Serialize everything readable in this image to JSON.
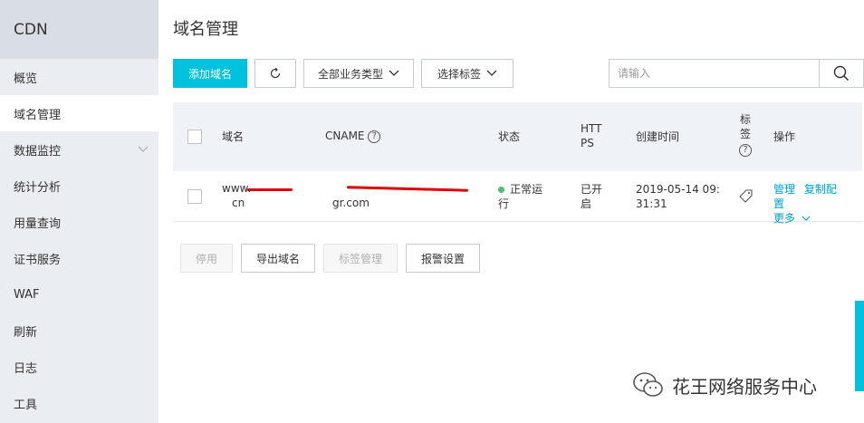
{
  "sidebar": {
    "title": "CDN",
    "items": [
      {
        "label": "概览"
      },
      {
        "label": "域名管理"
      },
      {
        "label": "数据监控"
      },
      {
        "label": "统计分析"
      },
      {
        "label": "用量查询"
      },
      {
        "label": "证书服务"
      },
      {
        "label": "WAF"
      },
      {
        "label": "刷新"
      },
      {
        "label": "日志"
      },
      {
        "label": "工具"
      }
    ]
  },
  "main": {
    "title": "域名管理",
    "toolbar": {
      "add_label": "添加域名",
      "biz_type_label": "全部业务类型",
      "tag_label": "选择标签"
    },
    "search": {
      "placeholder": "请输入"
    },
    "table": {
      "headers": {
        "domain": "域名",
        "cname": "CNAME",
        "status": "状态",
        "https": "HTTPS",
        "created": "创建时间",
        "tag": "标签",
        "actions": "操作"
      },
      "rows": [
        {
          "domain_line1": "www.",
          "domain_line2": "cn",
          "cname_line2": "gr.com",
          "status": "正常运行",
          "https": "已开启",
          "created_line1": "2019-05-14 09:",
          "created_line2": "31:31",
          "action_manage": "管理",
          "action_copy": "复制配置",
          "action_more": "更多"
        }
      ]
    },
    "bottom_buttons": {
      "disable": "停用",
      "export": "导出域名",
      "tag_manage": "标签管理",
      "alarm": "报警设置"
    }
  },
  "watermark": {
    "text": "花王网络服务中心"
  },
  "colors": {
    "primary": "#00c1de",
    "link": "#00a2ca",
    "status_ok": "#4ac26a",
    "redaction": "#e00000"
  }
}
